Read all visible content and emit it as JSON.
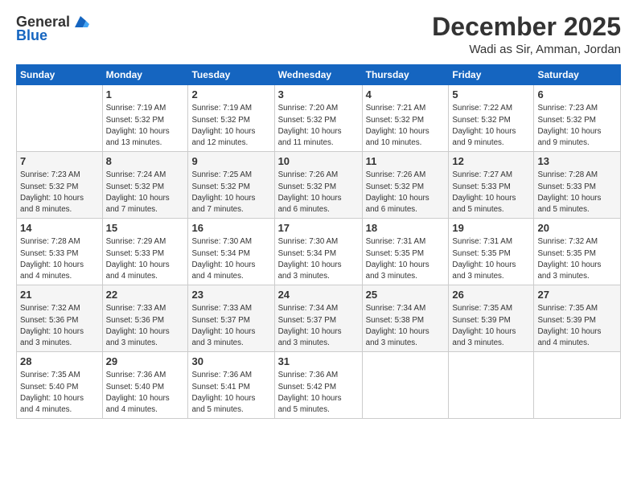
{
  "logo": {
    "general": "General",
    "blue": "Blue"
  },
  "header": {
    "month": "December 2025",
    "location": "Wadi as Sir, Amman, Jordan"
  },
  "weekdays": [
    "Sunday",
    "Monday",
    "Tuesday",
    "Wednesday",
    "Thursday",
    "Friday",
    "Saturday"
  ],
  "weeks": [
    [
      {
        "day": "",
        "info": ""
      },
      {
        "day": "1",
        "info": "Sunrise: 7:19 AM\nSunset: 5:32 PM\nDaylight: 10 hours\nand 13 minutes."
      },
      {
        "day": "2",
        "info": "Sunrise: 7:19 AM\nSunset: 5:32 PM\nDaylight: 10 hours\nand 12 minutes."
      },
      {
        "day": "3",
        "info": "Sunrise: 7:20 AM\nSunset: 5:32 PM\nDaylight: 10 hours\nand 11 minutes."
      },
      {
        "day": "4",
        "info": "Sunrise: 7:21 AM\nSunset: 5:32 PM\nDaylight: 10 hours\nand 10 minutes."
      },
      {
        "day": "5",
        "info": "Sunrise: 7:22 AM\nSunset: 5:32 PM\nDaylight: 10 hours\nand 9 minutes."
      },
      {
        "day": "6",
        "info": "Sunrise: 7:23 AM\nSunset: 5:32 PM\nDaylight: 10 hours\nand 9 minutes."
      }
    ],
    [
      {
        "day": "7",
        "info": "Sunrise: 7:23 AM\nSunset: 5:32 PM\nDaylight: 10 hours\nand 8 minutes."
      },
      {
        "day": "8",
        "info": "Sunrise: 7:24 AM\nSunset: 5:32 PM\nDaylight: 10 hours\nand 7 minutes."
      },
      {
        "day": "9",
        "info": "Sunrise: 7:25 AM\nSunset: 5:32 PM\nDaylight: 10 hours\nand 7 minutes."
      },
      {
        "day": "10",
        "info": "Sunrise: 7:26 AM\nSunset: 5:32 PM\nDaylight: 10 hours\nand 6 minutes."
      },
      {
        "day": "11",
        "info": "Sunrise: 7:26 AM\nSunset: 5:32 PM\nDaylight: 10 hours\nand 6 minutes."
      },
      {
        "day": "12",
        "info": "Sunrise: 7:27 AM\nSunset: 5:33 PM\nDaylight: 10 hours\nand 5 minutes."
      },
      {
        "day": "13",
        "info": "Sunrise: 7:28 AM\nSunset: 5:33 PM\nDaylight: 10 hours\nand 5 minutes."
      }
    ],
    [
      {
        "day": "14",
        "info": "Sunrise: 7:28 AM\nSunset: 5:33 PM\nDaylight: 10 hours\nand 4 minutes."
      },
      {
        "day": "15",
        "info": "Sunrise: 7:29 AM\nSunset: 5:33 PM\nDaylight: 10 hours\nand 4 minutes."
      },
      {
        "day": "16",
        "info": "Sunrise: 7:30 AM\nSunset: 5:34 PM\nDaylight: 10 hours\nand 4 minutes."
      },
      {
        "day": "17",
        "info": "Sunrise: 7:30 AM\nSunset: 5:34 PM\nDaylight: 10 hours\nand 3 minutes."
      },
      {
        "day": "18",
        "info": "Sunrise: 7:31 AM\nSunset: 5:35 PM\nDaylight: 10 hours\nand 3 minutes."
      },
      {
        "day": "19",
        "info": "Sunrise: 7:31 AM\nSunset: 5:35 PM\nDaylight: 10 hours\nand 3 minutes."
      },
      {
        "day": "20",
        "info": "Sunrise: 7:32 AM\nSunset: 5:35 PM\nDaylight: 10 hours\nand 3 minutes."
      }
    ],
    [
      {
        "day": "21",
        "info": "Sunrise: 7:32 AM\nSunset: 5:36 PM\nDaylight: 10 hours\nand 3 minutes."
      },
      {
        "day": "22",
        "info": "Sunrise: 7:33 AM\nSunset: 5:36 PM\nDaylight: 10 hours\nand 3 minutes."
      },
      {
        "day": "23",
        "info": "Sunrise: 7:33 AM\nSunset: 5:37 PM\nDaylight: 10 hours\nand 3 minutes."
      },
      {
        "day": "24",
        "info": "Sunrise: 7:34 AM\nSunset: 5:37 PM\nDaylight: 10 hours\nand 3 minutes."
      },
      {
        "day": "25",
        "info": "Sunrise: 7:34 AM\nSunset: 5:38 PM\nDaylight: 10 hours\nand 3 minutes."
      },
      {
        "day": "26",
        "info": "Sunrise: 7:35 AM\nSunset: 5:39 PM\nDaylight: 10 hours\nand 3 minutes."
      },
      {
        "day": "27",
        "info": "Sunrise: 7:35 AM\nSunset: 5:39 PM\nDaylight: 10 hours\nand 4 minutes."
      }
    ],
    [
      {
        "day": "28",
        "info": "Sunrise: 7:35 AM\nSunset: 5:40 PM\nDaylight: 10 hours\nand 4 minutes."
      },
      {
        "day": "29",
        "info": "Sunrise: 7:36 AM\nSunset: 5:40 PM\nDaylight: 10 hours\nand 4 minutes."
      },
      {
        "day": "30",
        "info": "Sunrise: 7:36 AM\nSunset: 5:41 PM\nDaylight: 10 hours\nand 5 minutes."
      },
      {
        "day": "31",
        "info": "Sunrise: 7:36 AM\nSunset: 5:42 PM\nDaylight: 10 hours\nand 5 minutes."
      },
      {
        "day": "",
        "info": ""
      },
      {
        "day": "",
        "info": ""
      },
      {
        "day": "",
        "info": ""
      }
    ]
  ]
}
